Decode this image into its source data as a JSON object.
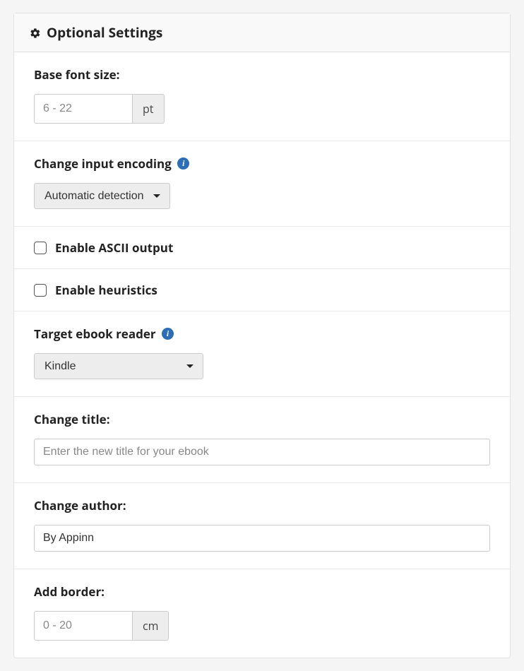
{
  "header": {
    "title": "Optional Settings"
  },
  "sections": {
    "font_size": {
      "label": "Base font size:",
      "placeholder": "6 - 22",
      "value": "",
      "unit": "pt"
    },
    "encoding": {
      "label": "Change input encoding",
      "selected": "Automatic detection"
    },
    "ascii": {
      "label": "Enable ASCII output",
      "checked": false
    },
    "heuristics": {
      "label": "Enable heuristics",
      "checked": false
    },
    "target_reader": {
      "label": "Target ebook reader",
      "selected": "Kindle"
    },
    "title": {
      "label": "Change title:",
      "placeholder": "Enter the new title for your ebook",
      "value": ""
    },
    "author": {
      "label": "Change author:",
      "value": "By Appinn"
    },
    "border": {
      "label": "Add border:",
      "placeholder": "0 - 20",
      "value": "",
      "unit": "cm"
    }
  }
}
